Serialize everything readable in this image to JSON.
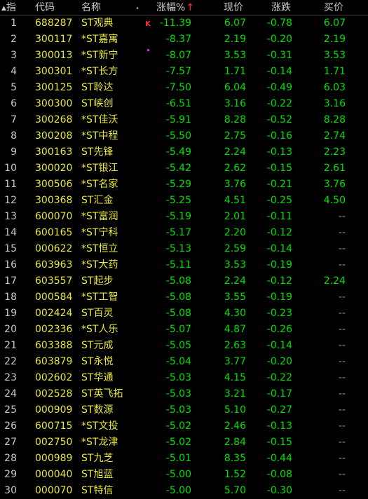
{
  "header": {
    "idx": "指",
    "code": "代码",
    "name": "名称",
    "dot": "•",
    "pct": "涨幅%",
    "pct_sort": "↑",
    "price": "现价",
    "chg": "涨跌",
    "bid": "买价"
  },
  "colors": {
    "background": "#000000",
    "code_name": "#e6e63c",
    "negative": "#00e000",
    "header_text": "#c8c8c8",
    "sort_arrow": "#ff3030"
  },
  "rows": [
    {
      "idx": "1",
      "code": "688287",
      "name": "ST观典",
      "mark": "K",
      "pct": "-11.39",
      "price": "6.07",
      "chg": "-0.78",
      "bid": "6.07"
    },
    {
      "idx": "2",
      "code": "300117",
      "name": "*ST嘉寓",
      "mark": "",
      "pct": "-8.37",
      "price": "2.19",
      "chg": "-0.20",
      "bid": "2.19"
    },
    {
      "idx": "3",
      "code": "300013",
      "name": "*ST新宁",
      "mark": "sq",
      "pct": "-8.07",
      "price": "3.53",
      "chg": "-0.31",
      "bid": "3.53"
    },
    {
      "idx": "4",
      "code": "300301",
      "name": "*ST长方",
      "mark": "",
      "pct": "-7.57",
      "price": "1.71",
      "chg": "-0.14",
      "bid": "1.71"
    },
    {
      "idx": "5",
      "code": "300125",
      "name": "ST聆达",
      "mark": "",
      "pct": "-7.50",
      "price": "6.04",
      "chg": "-0.49",
      "bid": "6.03"
    },
    {
      "idx": "6",
      "code": "300300",
      "name": "ST峡创",
      "mark": "",
      "pct": "-6.51",
      "price": "3.16",
      "chg": "-0.22",
      "bid": "3.16"
    },
    {
      "idx": "7",
      "code": "300268",
      "name": "*ST佳沃",
      "mark": "",
      "pct": "-5.91",
      "price": "8.28",
      "chg": "-0.52",
      "bid": "8.28"
    },
    {
      "idx": "8",
      "code": "300208",
      "name": "*ST中程",
      "mark": "",
      "pct": "-5.50",
      "price": "2.75",
      "chg": "-0.16",
      "bid": "2.74"
    },
    {
      "idx": "9",
      "code": "300163",
      "name": "ST先锋",
      "mark": "",
      "pct": "-5.49",
      "price": "2.24",
      "chg": "-0.13",
      "bid": "2.23"
    },
    {
      "idx": "10",
      "code": "300020",
      "name": "*ST银江",
      "mark": "",
      "pct": "-5.42",
      "price": "2.62",
      "chg": "-0.15",
      "bid": "2.61"
    },
    {
      "idx": "11",
      "code": "300506",
      "name": "*ST名家",
      "mark": "",
      "pct": "-5.29",
      "price": "3.76",
      "chg": "-0.21",
      "bid": "3.76"
    },
    {
      "idx": "12",
      "code": "300368",
      "name": "ST汇金",
      "mark": "",
      "pct": "-5.25",
      "price": "4.51",
      "chg": "-0.25",
      "bid": "4.50"
    },
    {
      "idx": "13",
      "code": "600070",
      "name": "*ST富润",
      "mark": "",
      "pct": "-5.19",
      "price": "2.01",
      "chg": "-0.11",
      "bid": "--"
    },
    {
      "idx": "14",
      "code": "600165",
      "name": "*ST宁科",
      "mark": "",
      "pct": "-5.17",
      "price": "2.20",
      "chg": "-0.12",
      "bid": "--"
    },
    {
      "idx": "15",
      "code": "000622",
      "name": "*ST恒立",
      "mark": "",
      "pct": "-5.13",
      "price": "2.59",
      "chg": "-0.14",
      "bid": "--"
    },
    {
      "idx": "16",
      "code": "603963",
      "name": "*ST大药",
      "mark": "",
      "pct": "-5.11",
      "price": "3.53",
      "chg": "-0.19",
      "bid": "--"
    },
    {
      "idx": "17",
      "code": "603557",
      "name": "ST起步",
      "mark": "",
      "pct": "-5.08",
      "price": "2.24",
      "chg": "-0.12",
      "bid": "2.24"
    },
    {
      "idx": "18",
      "code": "000584",
      "name": "*ST工智",
      "mark": "",
      "pct": "-5.08",
      "price": "3.55",
      "chg": "-0.19",
      "bid": "--"
    },
    {
      "idx": "19",
      "code": "002424",
      "name": "ST百灵",
      "mark": "",
      "pct": "-5.08",
      "price": "4.30",
      "chg": "-0.23",
      "bid": "--"
    },
    {
      "idx": "20",
      "code": "002336",
      "name": "*ST人乐",
      "mark": "",
      "pct": "-5.07",
      "price": "4.87",
      "chg": "-0.26",
      "bid": "--"
    },
    {
      "idx": "21",
      "code": "603388",
      "name": "ST元成",
      "mark": "",
      "pct": "-5.05",
      "price": "2.63",
      "chg": "-0.14",
      "bid": "--"
    },
    {
      "idx": "22",
      "code": "603879",
      "name": "ST永悦",
      "mark": "",
      "pct": "-5.04",
      "price": "3.77",
      "chg": "-0.20",
      "bid": "--"
    },
    {
      "idx": "23",
      "code": "002602",
      "name": "ST华通",
      "mark": "",
      "pct": "-5.03",
      "price": "4.15",
      "chg": "-0.22",
      "bid": "--"
    },
    {
      "idx": "24",
      "code": "002528",
      "name": "ST英飞拓",
      "mark": "",
      "pct": "-5.03",
      "price": "3.21",
      "chg": "-0.17",
      "bid": "--"
    },
    {
      "idx": "25",
      "code": "000909",
      "name": "ST数源",
      "mark": "",
      "pct": "-5.03",
      "price": "5.10",
      "chg": "-0.27",
      "bid": "--"
    },
    {
      "idx": "26",
      "code": "600715",
      "name": "*ST文投",
      "mark": "",
      "pct": "-5.02",
      "price": "2.46",
      "chg": "-0.13",
      "bid": "--"
    },
    {
      "idx": "27",
      "code": "002750",
      "name": "*ST龙津",
      "mark": "",
      "pct": "-5.02",
      "price": "2.84",
      "chg": "-0.15",
      "bid": "--"
    },
    {
      "idx": "28",
      "code": "000989",
      "name": "ST九芝",
      "mark": "",
      "pct": "-5.01",
      "price": "8.35",
      "chg": "-0.44",
      "bid": "--"
    },
    {
      "idx": "29",
      "code": "000040",
      "name": "ST旭蓝",
      "mark": "",
      "pct": "-5.00",
      "price": "1.52",
      "chg": "-0.08",
      "bid": "--"
    },
    {
      "idx": "30",
      "code": "000070",
      "name": "ST特信",
      "mark": "",
      "pct": "-5.00",
      "price": "5.70",
      "chg": "-0.30",
      "bid": "--"
    }
  ]
}
